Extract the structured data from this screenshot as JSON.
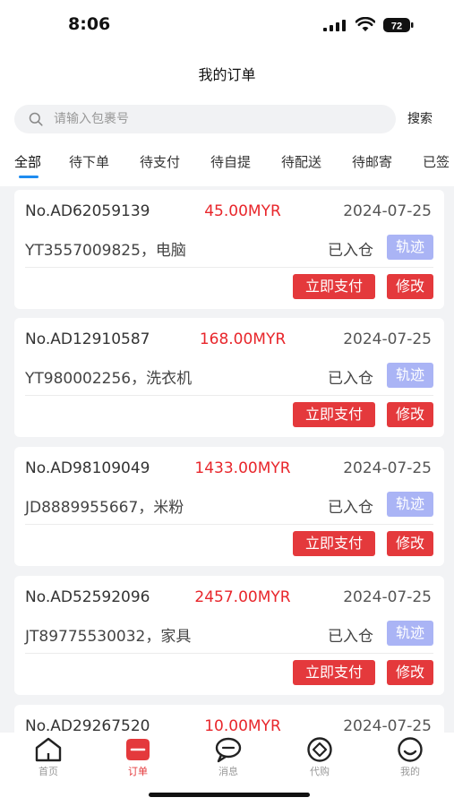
{
  "status_bar": {
    "time": "8:06",
    "battery": "72"
  },
  "header": {
    "title": "我的订单"
  },
  "search": {
    "placeholder": "请输入包裹号",
    "button_label": "搜索"
  },
  "tabs": [
    "全部",
    "待下单",
    "待支付",
    "待自提",
    "待配送",
    "待邮寄",
    "已签"
  ],
  "active_tab": "全部",
  "orders": [
    {
      "order_no": "No.AD62059139",
      "amount": "45.00MYR",
      "date": "2024-07-25",
      "item": "YT3557009825，电脑",
      "status": "已入仓",
      "track_label": "轨迹",
      "pay_label": "立即支付",
      "edit_label": "修改"
    },
    {
      "order_no": "No.AD12910587",
      "amount": "168.00MYR",
      "date": "2024-07-25",
      "item": "YT980002256，洗衣机",
      "status": "已入仓",
      "track_label": "轨迹",
      "pay_label": "立即支付",
      "edit_label": "修改"
    },
    {
      "order_no": "No.AD98109049",
      "amount": "1433.00MYR",
      "date": "2024-07-25",
      "item": "JD8889955667，米粉",
      "status": "已入仓",
      "track_label": "轨迹",
      "pay_label": "立即支付",
      "edit_label": "修改"
    },
    {
      "order_no": "No.AD52592096",
      "amount": "2457.00MYR",
      "date": "2024-07-25",
      "item": "JT89775530032，家具",
      "status": "已入仓",
      "track_label": "轨迹",
      "pay_label": "立即支付",
      "edit_label": "修改"
    },
    {
      "order_no": "No.AD29267520",
      "amount": "10.00MYR",
      "date": "2024-07-25"
    }
  ],
  "tab_bar": [
    {
      "label": "首页",
      "icon": "home-icon"
    },
    {
      "label": "订单",
      "icon": "order-icon"
    },
    {
      "label": "消息",
      "icon": "message-icon"
    },
    {
      "label": "代购",
      "icon": "purchase-icon"
    },
    {
      "label": "我的",
      "icon": "profile-icon"
    }
  ],
  "colors": {
    "accent": "#e4393c",
    "track": "#aab4f5",
    "tab_underline": "#1e8cf0",
    "amount": "#e8262b"
  }
}
